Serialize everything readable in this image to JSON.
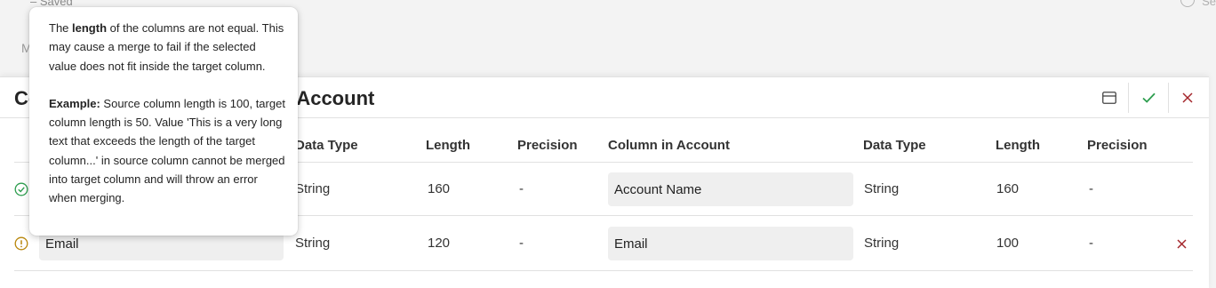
{
  "background": {
    "saved_label": "Saved",
    "m_label": "M",
    "right_label": "Se"
  },
  "dialog": {
    "title": "Co                                    Account",
    "title_left": "Co",
    "title_right": "Account",
    "actions": {
      "layout_icon": "layout-icon",
      "confirm_icon": "checkmark-icon",
      "close_icon": "close-icon"
    }
  },
  "columns": {
    "source_data_type": "Data Type",
    "source_length": "Length",
    "source_precision": "Precision",
    "target_column": "Column in Account",
    "target_data_type": "Data Type",
    "target_length": "Length",
    "target_precision": "Precision"
  },
  "rows": [
    {
      "status": "ok",
      "source_column": "",
      "source_data_type": "String",
      "source_length": "160",
      "source_precision": "-",
      "target_column": "Account Name",
      "target_data_type": "String",
      "target_length": "160",
      "target_precision": "-"
    },
    {
      "status": "warning",
      "source_column": "Email",
      "source_data_type": "String",
      "source_length": "120",
      "source_precision": "-",
      "target_column": "Email",
      "target_data_type": "String",
      "target_length": "100",
      "target_precision": "-"
    }
  ],
  "tooltip": {
    "p1_pre": "The ",
    "p1_bold": "length",
    "p1_post": " of the columns are not equal. This may cause a merge to fail if the selected value does not fit inside the target column.",
    "p2_bold": "Example:",
    "p2_post": " Source column length is 100, target column length is 50. Value 'This is a very long text that exceeds the length of the target column...' in source column cannot be merged into target column and will throw an error when merging."
  },
  "colors": {
    "ok": "#2e9e4f",
    "warning": "#b8860b",
    "delete": "#a4262c",
    "confirm": "#2e9e4f"
  }
}
